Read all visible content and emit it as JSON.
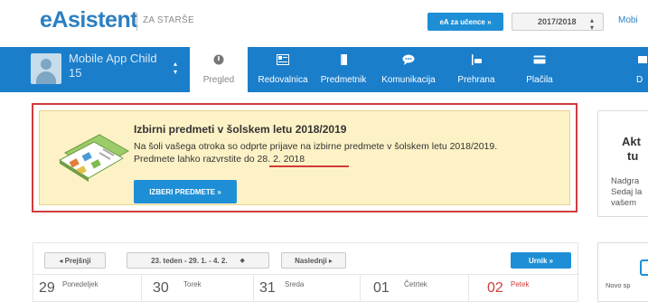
{
  "header": {
    "logo": "eAsistent",
    "logo_sub": "ZA STARŠE",
    "ucence_button": "eA za učence »",
    "year": "2017/2018",
    "mobile_link": "Mobi"
  },
  "child": {
    "name_line1": "Mobile App Child",
    "name_line2": "15"
  },
  "nav": {
    "items": [
      {
        "label": "Pregled",
        "icon": "gauge-icon"
      },
      {
        "label": "Redovalnica",
        "icon": "gradebook-icon"
      },
      {
        "label": "Predmetnik",
        "icon": "book-icon"
      },
      {
        "label": "Komunikacija",
        "icon": "chat-bubble-icon"
      },
      {
        "label": "Prehrana",
        "icon": "food-icon"
      },
      {
        "label": "Plačila",
        "icon": "card-icon"
      },
      {
        "label": "D"
      }
    ]
  },
  "alert": {
    "title": "Izbirni predmeti v šolskem letu 2018/2019",
    "line1": "Na šoli vašega otroka so odprte prijave na izbirne predmete v šolskem letu 2018/2019.",
    "line2": "Predmete lahko razvrstite do 28. 2. 2018",
    "button": "IZBERI PREDMETE »"
  },
  "side": {
    "title_line1": "Akt",
    "title_line2": "tu",
    "text_line1": "Nadgra",
    "text_line2": "Sedaj la",
    "text_line3": "vašem"
  },
  "calendar": {
    "prev": "◂ Prejšnji",
    "week": "23. teden - 29. 1. - 4. 2.",
    "next": "Naslednji ▸",
    "urnik": "Urnik »",
    "days": [
      {
        "num": "29",
        "name": "Ponedeljek"
      },
      {
        "num": "30",
        "name": "Torek"
      },
      {
        "num": "31",
        "name": "Sreda"
      },
      {
        "num": "01",
        "name": "Četrtek"
      },
      {
        "num": "02",
        "name": "Petek"
      }
    ],
    "side_label": "Novo sp"
  },
  "colors": {
    "brand_blue": "#1a7ecb",
    "alert_bg": "#fdf2c6",
    "highlight_red": "#d13b3b"
  }
}
